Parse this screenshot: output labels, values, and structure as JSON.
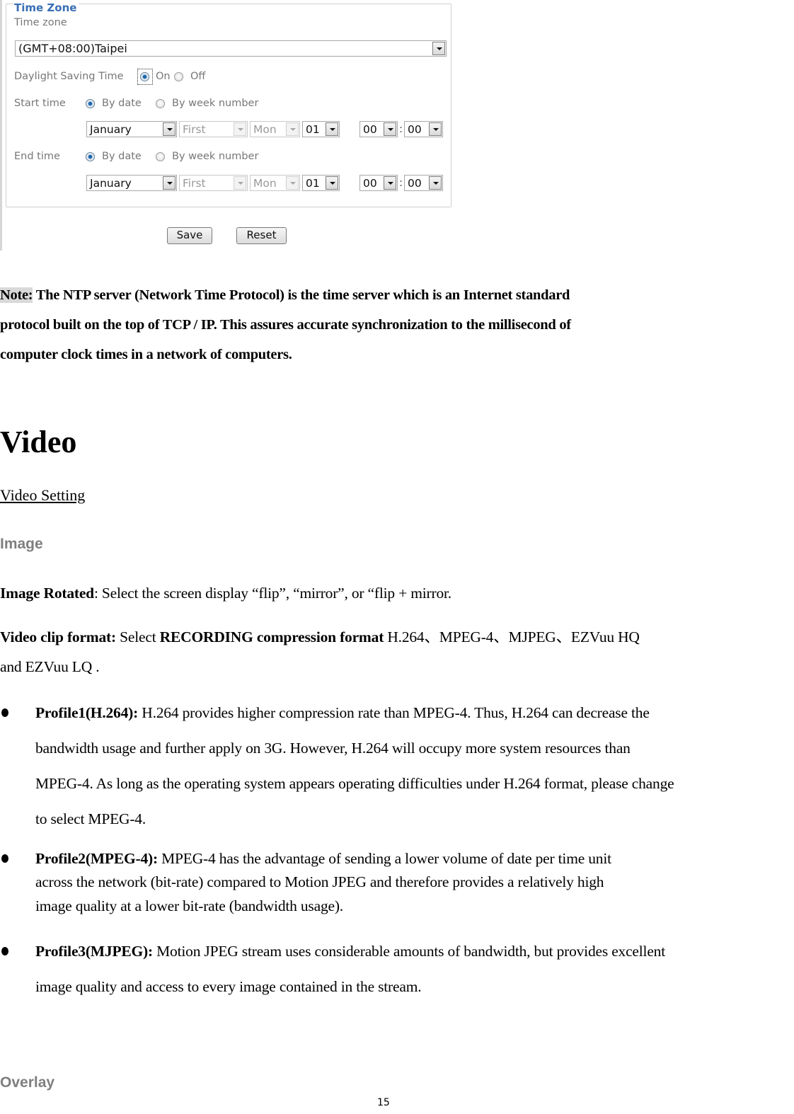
{
  "time_zone_panel": {
    "legend": "Time Zone",
    "time_zone_label": "Time zone",
    "time_zone_value": "(GMT+08:00)Taipei",
    "dst_label": "Daylight Saving Time",
    "dst_on_label": "On",
    "dst_off_label": "Off",
    "dst_selected": "On",
    "start": {
      "label": "Start time",
      "by_date_label": "By date",
      "by_week_label": "By week number",
      "mode_selected": "By date",
      "month": "January",
      "week": "First",
      "weekday": "Mon",
      "day": "01",
      "hour": "00",
      "minute": "00"
    },
    "end": {
      "label": "End time",
      "by_date_label": "By date",
      "by_week_label": "By week number",
      "mode_selected": "By date",
      "month": "January",
      "week": "First",
      "weekday": "Mon",
      "day": "01",
      "hour": "00",
      "minute": "00"
    },
    "time_separator": ":",
    "save_label": "Save",
    "reset_label": "Reset"
  },
  "note": {
    "prefix": "Note:",
    "line1": " The NTP server (Network Time Protocol) is the time server which is an Internet standard",
    "line2": "protocol built on the top of TCP / IP. This assures accurate synchronization to the millisecond of",
    "line3": "computer clock times in a network of computers."
  },
  "video": {
    "heading": "Video",
    "link": "Video Setting",
    "image_heading": "Image",
    "image_rotated_label": "Image Rotated",
    "image_rotated_text": ": Select the screen display “flip”, “mirror”, or “flip + mirror.",
    "clip_format_label": "Video clip format:",
    "clip_format_select": " Select ",
    "clip_format_bold": "RECORDING compression format",
    "clip_format_rest": " H.264、MPEG-4、MJPEG、EZVuu HQ",
    "clip_format_line2": "and EZVuu LQ .",
    "profiles": [
      {
        "label": "Profile1(H.264):",
        "lines": [
          " H.264 provides higher compression rate than MPEG-4. Thus, H.264 can decrease the",
          "bandwidth usage and further apply on 3G. However, H.264 will occupy more system resources than",
          "MPEG-4. As long as the operating system appears operating difficulties under H.264 format, please change",
          "to select MPEG-4."
        ]
      },
      {
        "label": "Profile2(MPEG-4):",
        "lines": [
          " MPEG-4 has the advantage of sending a lower volume of date per time unit",
          "across the network (bit-rate) compared to Motion JPEG and therefore provides a relatively high",
          "image quality at a lower bit-rate (bandwidth usage)."
        ]
      },
      {
        "label": "Profile3(MJPEG):",
        "lines": [
          " Motion JPEG stream uses considerable amounts of bandwidth, but provides excellent",
          "image quality and access to every image contained in the stream."
        ]
      }
    ],
    "overlay_heading": "Overlay"
  },
  "page_number": "15"
}
